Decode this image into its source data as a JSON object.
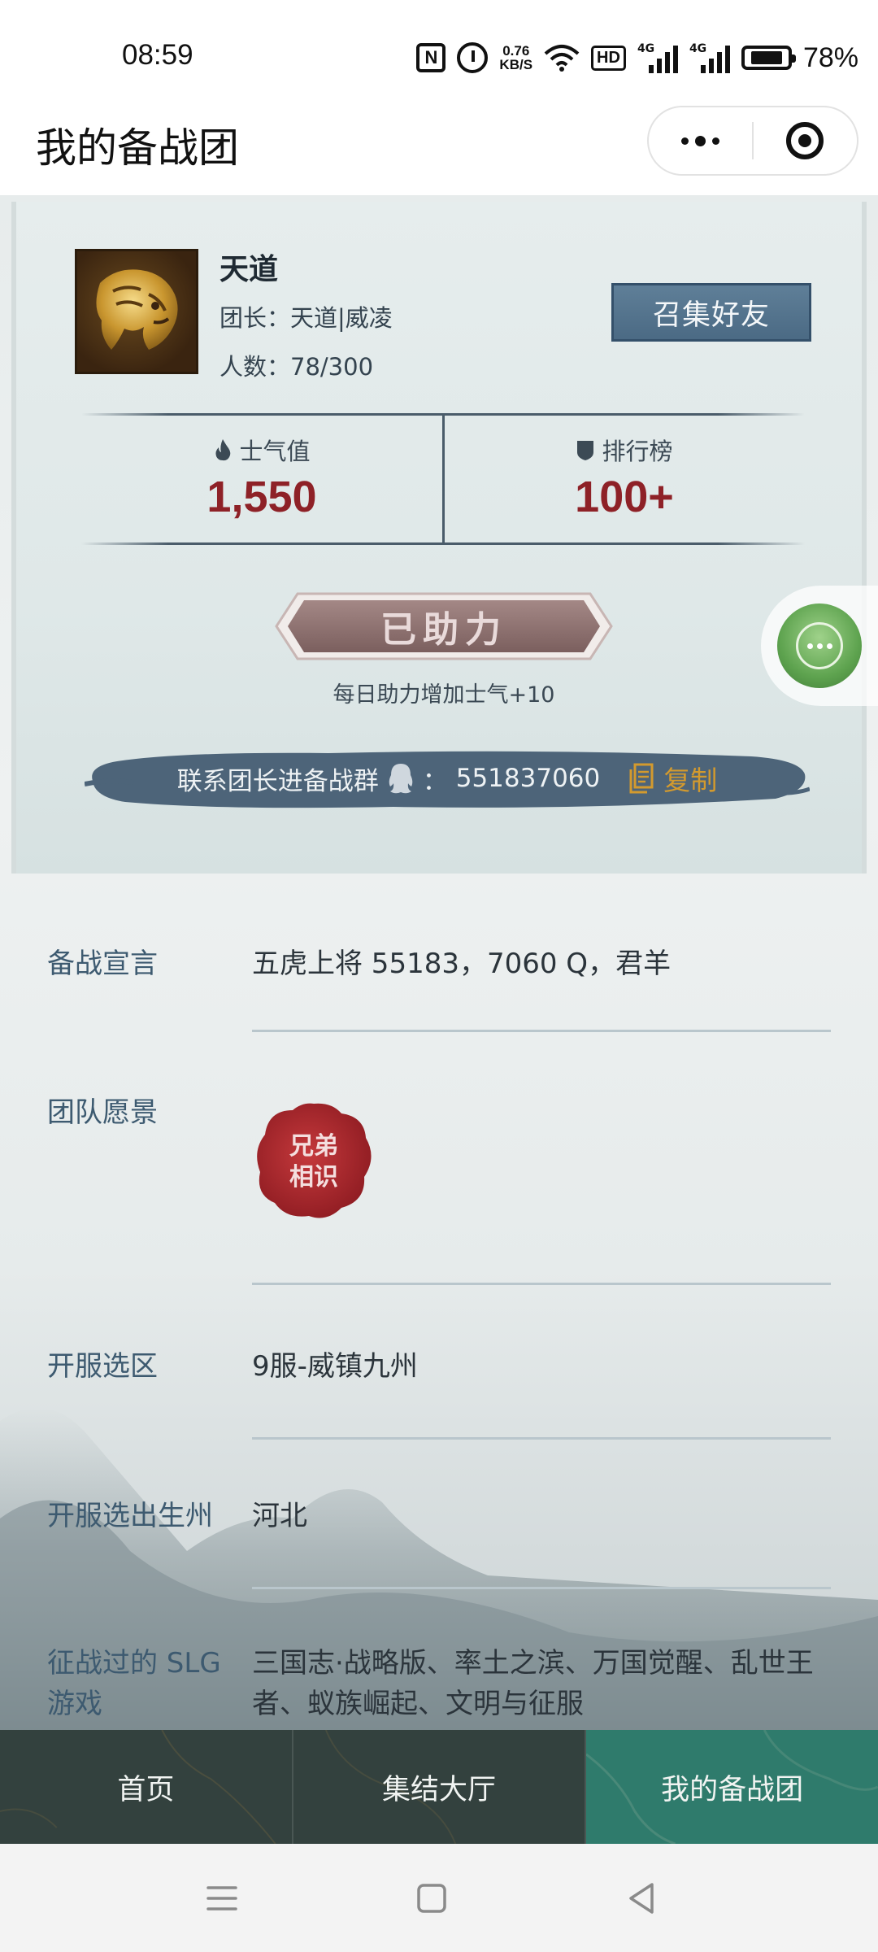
{
  "status_bar": {
    "time": "08:59",
    "nfc": "N",
    "speed_value": "0.76",
    "speed_unit": "KB/S",
    "hd": "HD",
    "signal_1": "4G",
    "signal_2": "4G",
    "battery_level": 0.78,
    "battery_text": "78%"
  },
  "header": {
    "title": "我的备战团"
  },
  "team": {
    "name": "天道",
    "leader": "团长：天道|威凌",
    "members": "人数：78/300",
    "gather_label": "召集好友"
  },
  "stats": {
    "morale_label": "士气值",
    "morale_value": "1,550",
    "rank_label": "排行榜",
    "rank_value": "100+"
  },
  "assist": {
    "label": "已助力",
    "note": "每日助力增加士气+10"
  },
  "contact": {
    "text": "联系团长进备战群",
    "separator": "：",
    "qq_number": "551837060",
    "copy_label": "复制"
  },
  "seal_text": [
    "兄弟",
    "相识"
  ],
  "form": [
    {
      "label": "备战宣言",
      "value": "五虎上将 55183，7060 Q，君羊"
    },
    {
      "label": "团队愿景",
      "value": ""
    },
    {
      "label": "开服选区",
      "value": "9服-威镇九州"
    },
    {
      "label": "开服选出生州",
      "value": "河北"
    },
    {
      "label": "征战过的 SLG 游戏",
      "value": "三国志·战略版、率土之滨、万国觉醒、乱世王者、蚁族崛起、文明与征服"
    }
  ],
  "tabs": [
    {
      "label": "首页"
    },
    {
      "label": "集结大厅"
    },
    {
      "label": "我的备战团"
    }
  ],
  "colors": {
    "accent_red": "#8e2127",
    "button_blue": "#4b6a84",
    "tab_active": "#2f7b6c",
    "tab_bg": "#33413e",
    "copy_gold": "#d39a2e"
  }
}
